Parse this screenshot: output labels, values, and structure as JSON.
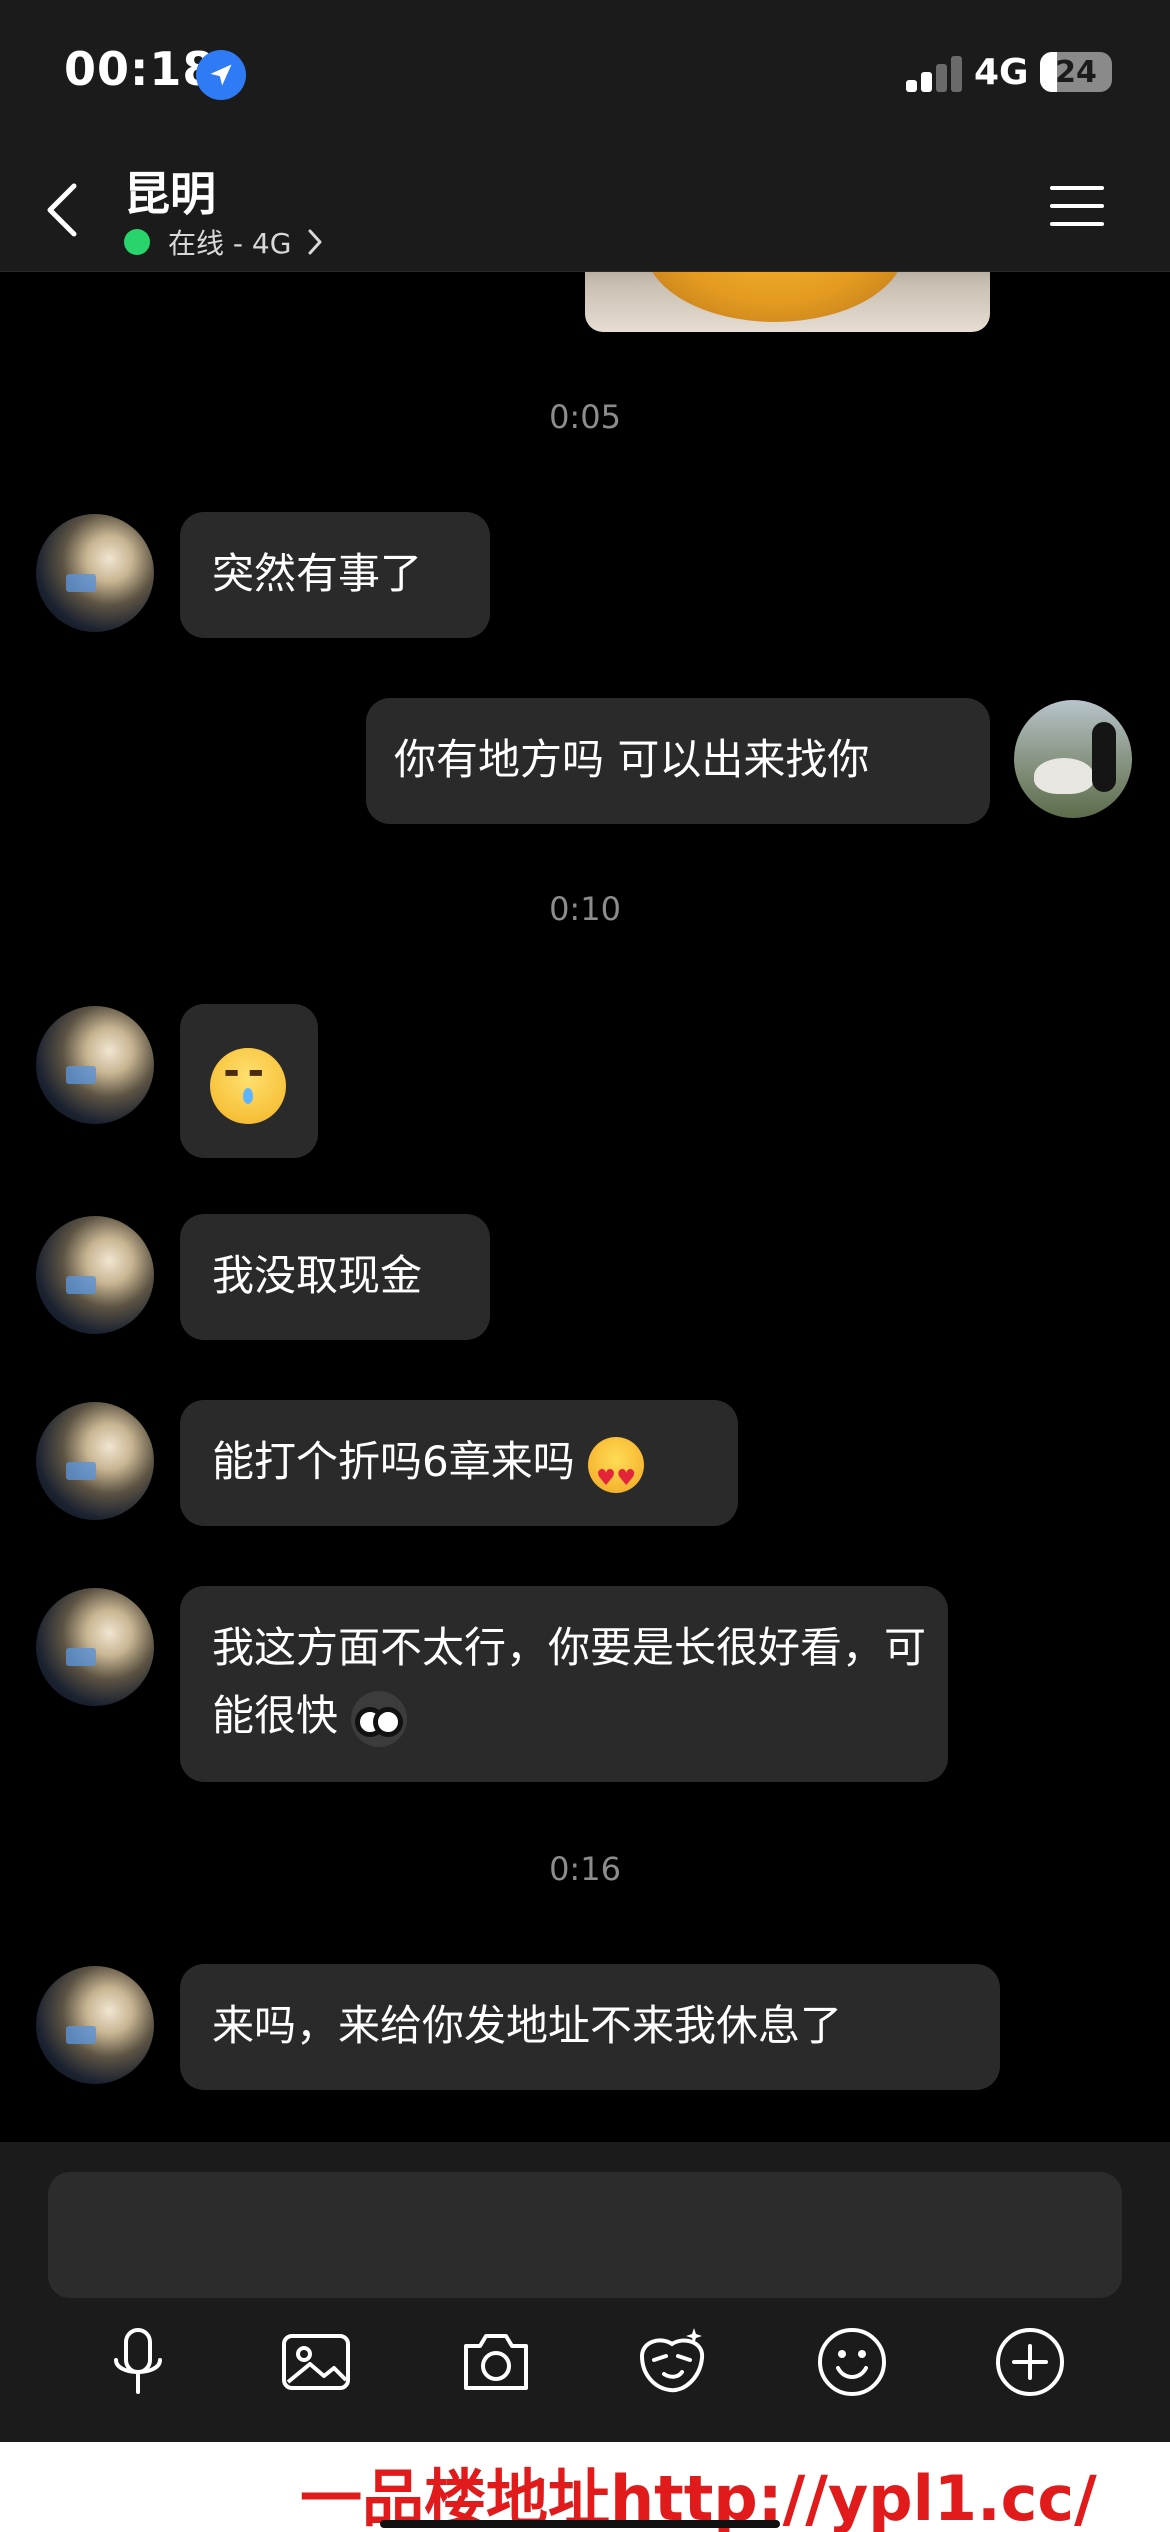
{
  "status_bar": {
    "time": "00:18",
    "network": "4G",
    "battery": "24",
    "battery_level": 0.24,
    "signal_bars_active": 2,
    "signal_bars_total": 4,
    "location_icon": "location-arrow-icon"
  },
  "header": {
    "back_icon": "chevron-left-icon",
    "contact_name": "昆明",
    "status": "在线 - 4G",
    "status_color": "#28d46b",
    "menu_icon": "hamburger-menu-icon"
  },
  "messages": {
    "time_1": "0:05",
    "m1": "突然有事了",
    "m2": "你有地方吗 可以出来找你",
    "time_2": "0:10",
    "m4": "我没取现金",
    "m5": "能打个折吗6章来吗",
    "m6": "我这方面不太行，你要是长很好看，可能很快",
    "time_3": "0:16",
    "m7": "来吗，来给你发地址不来我休息了"
  },
  "input": {
    "placeholder": ""
  },
  "toolbar": {
    "icons": [
      "microphone-icon",
      "image-icon",
      "camera-icon",
      "sticker-icon",
      "emoji-icon",
      "plus-icon"
    ]
  },
  "watermark": {
    "text": "一品楼地址http://ypl1.cc/"
  },
  "colors": {
    "background": "#000000",
    "bar": "#1b1b1b",
    "bubble": "#2a2a2a",
    "accent_blue": "#2f7bf6",
    "online_green": "#28d46b",
    "watermark_red": "#e11b1b"
  }
}
